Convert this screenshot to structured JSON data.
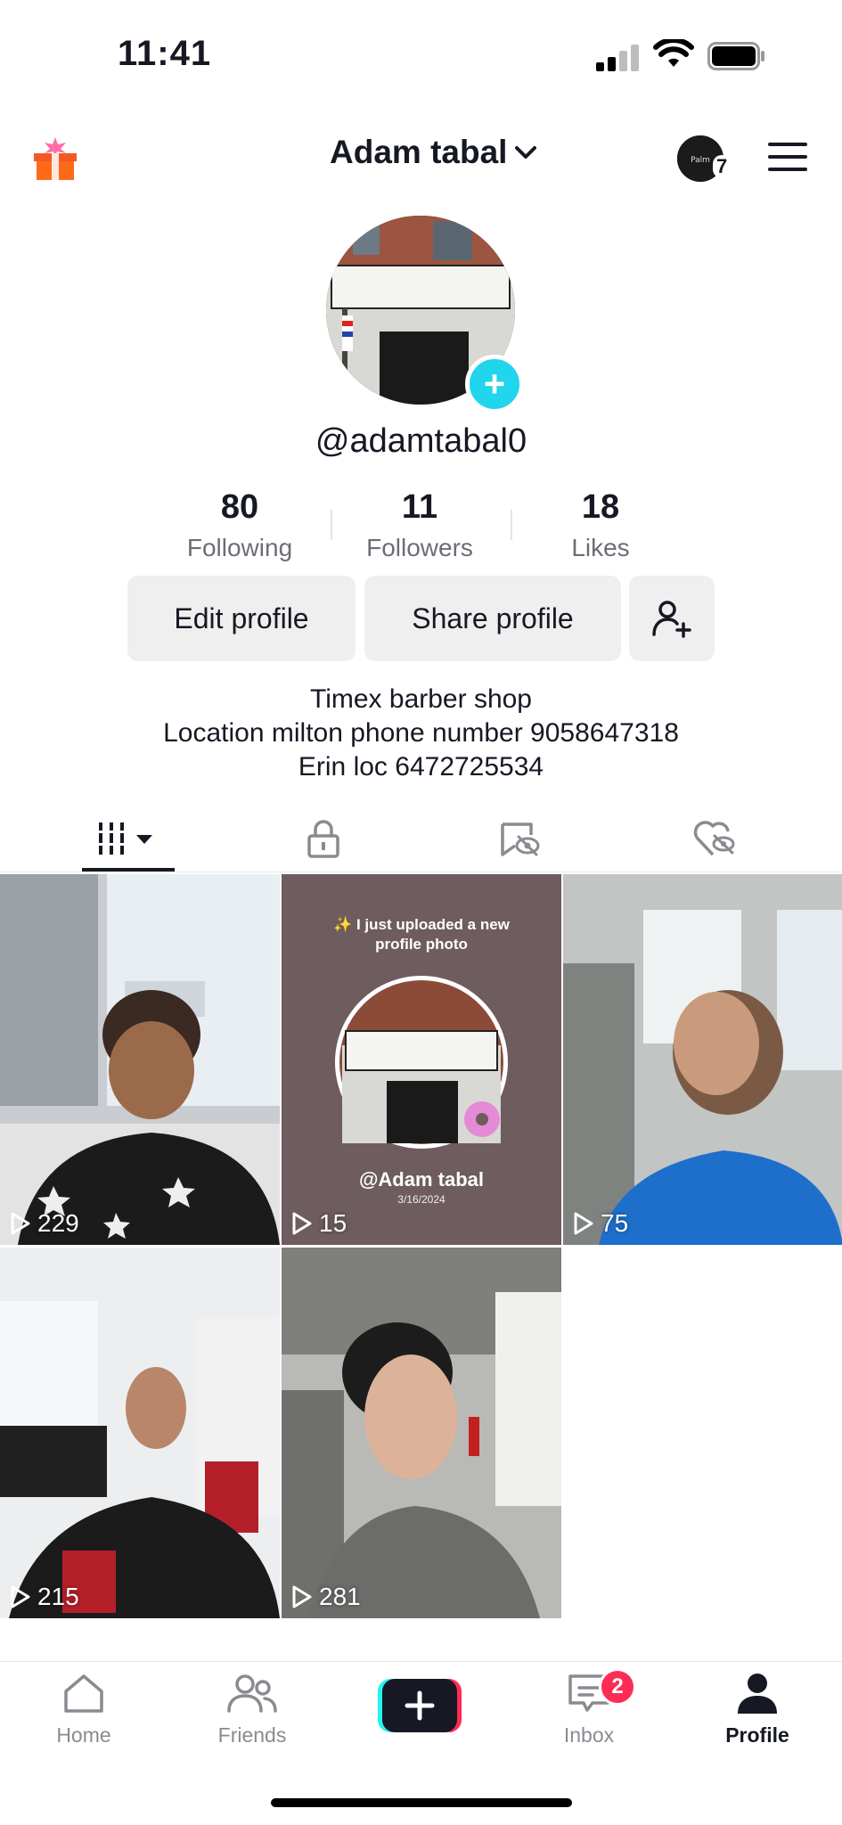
{
  "status_bar": {
    "time": "11:41"
  },
  "header": {
    "title": "Adam tabal",
    "notification_count": "7"
  },
  "profile": {
    "handle": "@adamtabal0"
  },
  "stats": [
    {
      "value": "80",
      "label": "Following"
    },
    {
      "value": "11",
      "label": "Followers"
    },
    {
      "value": "18",
      "label": "Likes"
    }
  ],
  "actions": {
    "edit_label": "Edit profile",
    "share_label": "Share profile"
  },
  "bio": {
    "line1": "Timex barber shop",
    "line2": "Location milton phone number 9058647318",
    "line3": "Erin loc 6472725534"
  },
  "tabs": [
    "videos-icon",
    "lock-icon",
    "hidden-icon",
    "liked-icon"
  ],
  "videos": [
    {
      "views": "229"
    },
    {
      "views": "15",
      "caption": "✨ I just uploaded a new profile photo",
      "author": "@Adam tabal",
      "date": "3/16/2024"
    },
    {
      "views": "75"
    },
    {
      "views": "215"
    },
    {
      "views": "281"
    }
  ],
  "nav": {
    "home": "Home",
    "friends": "Friends",
    "inbox": "Inbox",
    "inbox_badge": "2",
    "profile": "Profile"
  },
  "colors": {
    "accent_cyan": "#20d5ec",
    "accent_red": "#fe2c55",
    "text": "#161823",
    "muted": "#6b6e76"
  }
}
